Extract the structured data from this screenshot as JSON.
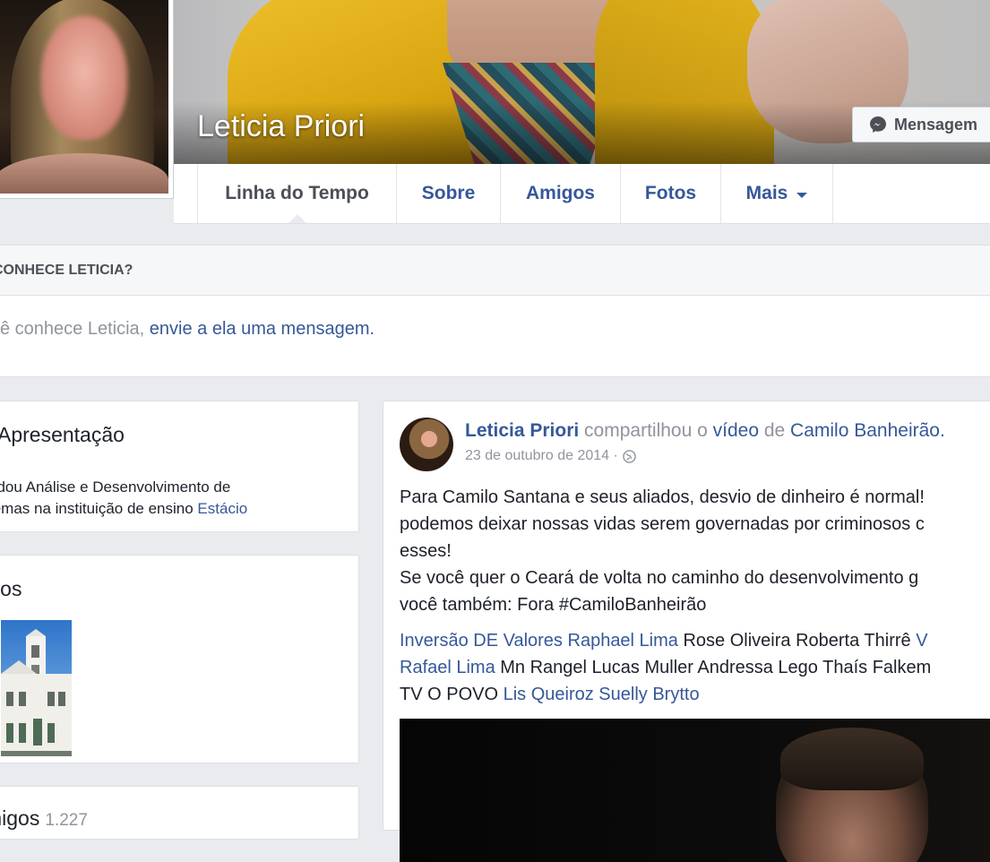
{
  "profile": {
    "name": "Leticia Priori",
    "message_button": "Mensagem"
  },
  "nav": {
    "tabs": [
      "Linha do Tempo",
      "Sobre",
      "Amigos",
      "Fotos",
      "Mais"
    ]
  },
  "know": {
    "title": "CONHECE LETICIA?",
    "text": "cê conhece Leticia, ",
    "link": "envie a ela uma mensagem."
  },
  "intro": {
    "title": "Apresentação",
    "text": "udou Análise e Desenvolvimento de temas na instituição de ensino ",
    "link": "Estácio"
  },
  "photos": {
    "title": "otos"
  },
  "friends": {
    "title": "migos",
    "count": "1.227"
  },
  "post": {
    "author": "Leticia Priori",
    "verb": " compartilhou o ",
    "object": "vídeo",
    "prep": " de ",
    "page": "Camilo Banheirão.",
    "date": "23 de outubro de 2014 · ",
    "body_lines": [
      "Para Camilo Santana e seus aliados, desvio de dinheiro é normal!",
      "podemos deixar nossas vidas serem governadas por criminosos c",
      "esses!",
      "Se você quer o Ceará de volta no caminho do desenvolvimento g",
      "você também: Fora #CamiloBanheirão"
    ],
    "tags_line1": [
      {
        "text": "Inversão DE Valores",
        "link": true
      },
      {
        "text": " ",
        "link": false
      },
      {
        "text": "Raphael Lima",
        "link": true
      },
      {
        "text": " Rose Oliveira Roberta Thirrê ",
        "link": false
      },
      {
        "text": "V",
        "link": true
      }
    ],
    "tags_line2": [
      {
        "text": "Rafael Lima",
        "link": true
      },
      {
        "text": " Mn Rangel Lucas Muller Andressa Lego Thaís Falkem",
        "link": false
      }
    ],
    "tags_line3": [
      {
        "text": "TV O POVO ",
        "link": false
      },
      {
        "text": "Lis Queiroz",
        "link": true
      },
      {
        "text": " ",
        "link": false
      },
      {
        "text": "Suelly Brytto",
        "link": true
      }
    ]
  },
  "colors": {
    "link": "#365899",
    "page_bg": "#e9ebee"
  }
}
